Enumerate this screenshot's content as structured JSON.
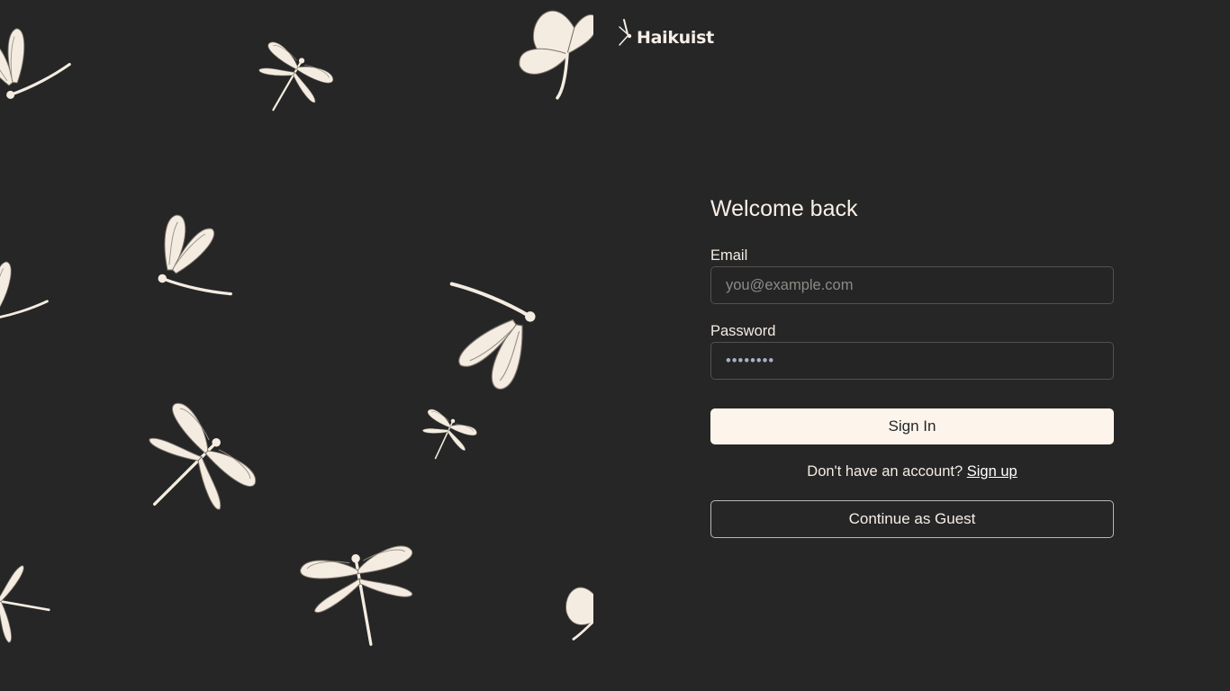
{
  "brand": {
    "logo_text": "Haikuist"
  },
  "form": {
    "title": "Welcome back",
    "email": {
      "label": "Email",
      "placeholder": "you@example.com",
      "value": ""
    },
    "password": {
      "label": "Password",
      "value": "••••••••"
    },
    "sign_in_label": "Sign In",
    "signup_prompt": "Don't have an account?",
    "signup_link": "Sign up",
    "guest_label": "Continue as Guest"
  },
  "colors": {
    "background": "#262626",
    "primary_button": "#fdf5eb",
    "text": "#f3ece4",
    "illustration": "#f4ece1"
  },
  "decor": {
    "illustrations": [
      "dragonfly-icon",
      "butterfly-icon",
      "flower-icon"
    ]
  }
}
